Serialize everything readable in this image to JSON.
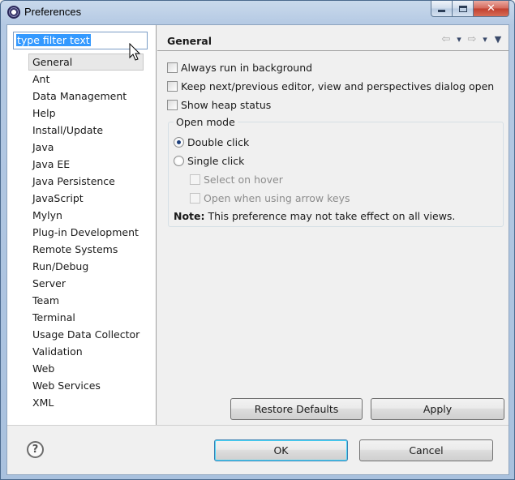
{
  "window": {
    "title": "Preferences",
    "minimize_glyph": "",
    "maximize_glyph": "",
    "close_glyph": "✕"
  },
  "filter": {
    "value": "type filter text"
  },
  "tree": {
    "items": [
      {
        "label": "General",
        "selected": true
      },
      {
        "label": "Ant"
      },
      {
        "label": "Data Management"
      },
      {
        "label": "Help"
      },
      {
        "label": "Install/Update"
      },
      {
        "label": "Java"
      },
      {
        "label": "Java EE"
      },
      {
        "label": "Java Persistence"
      },
      {
        "label": "JavaScript"
      },
      {
        "label": "Mylyn"
      },
      {
        "label": "Plug-in Development"
      },
      {
        "label": "Remote Systems"
      },
      {
        "label": "Run/Debug"
      },
      {
        "label": "Server"
      },
      {
        "label": "Team"
      },
      {
        "label": "Terminal"
      },
      {
        "label": "Usage Data Collector"
      },
      {
        "label": "Validation"
      },
      {
        "label": "Web"
      },
      {
        "label": "Web Services"
      },
      {
        "label": "XML"
      }
    ]
  },
  "page": {
    "title": "General",
    "options": {
      "run_in_background": {
        "label": "Always run in background",
        "checked": false
      },
      "keep_dialog_open": {
        "label": "Keep next/previous editor, view and perspectives dialog open",
        "checked": false
      },
      "show_heap": {
        "label": "Show heap status",
        "checked": false
      }
    },
    "open_mode": {
      "title": "Open mode",
      "double_click": {
        "label": "Double click",
        "checked": true
      },
      "single_click": {
        "label": "Single click",
        "checked": false
      },
      "select_on_hover": {
        "label": "Select on hover",
        "enabled": false
      },
      "open_arrow_keys": {
        "label": "Open when using arrow keys",
        "enabled": false
      },
      "note_label": "Note:",
      "note_text": " This preference may not take effect on all views."
    }
  },
  "buttons": {
    "restore_defaults": "Restore Defaults",
    "apply": "Apply",
    "ok": "OK",
    "cancel": "Cancel",
    "help": "?"
  },
  "icons": {
    "back": "back-arrow-icon",
    "forward": "forward-arrow-icon",
    "view_menu": "view-menu-icon",
    "help": "help-icon",
    "app": "eclipse-icon"
  },
  "colors": {
    "selection": "#3399ff",
    "default_button_border": "#3c7fb1"
  }
}
